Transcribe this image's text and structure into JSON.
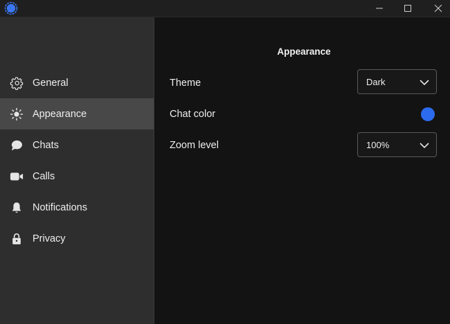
{
  "colors": {
    "chat_color": "#2c6bed",
    "app_icon": "#3a76f0"
  },
  "sidebar": {
    "items": [
      {
        "label": "General",
        "icon": "gear-icon"
      },
      {
        "label": "Appearance",
        "icon": "sun-icon"
      },
      {
        "label": "Chats",
        "icon": "chat-bubble-icon"
      },
      {
        "label": "Calls",
        "icon": "video-camera-icon"
      },
      {
        "label": "Notifications",
        "icon": "bell-icon"
      },
      {
        "label": "Privacy",
        "icon": "lock-icon"
      }
    ],
    "active_index": 1
  },
  "main": {
    "title": "Appearance",
    "theme": {
      "label": "Theme",
      "value": "Dark"
    },
    "chat_color": {
      "label": "Chat color"
    },
    "zoom": {
      "label": "Zoom level",
      "value": "100%"
    }
  }
}
